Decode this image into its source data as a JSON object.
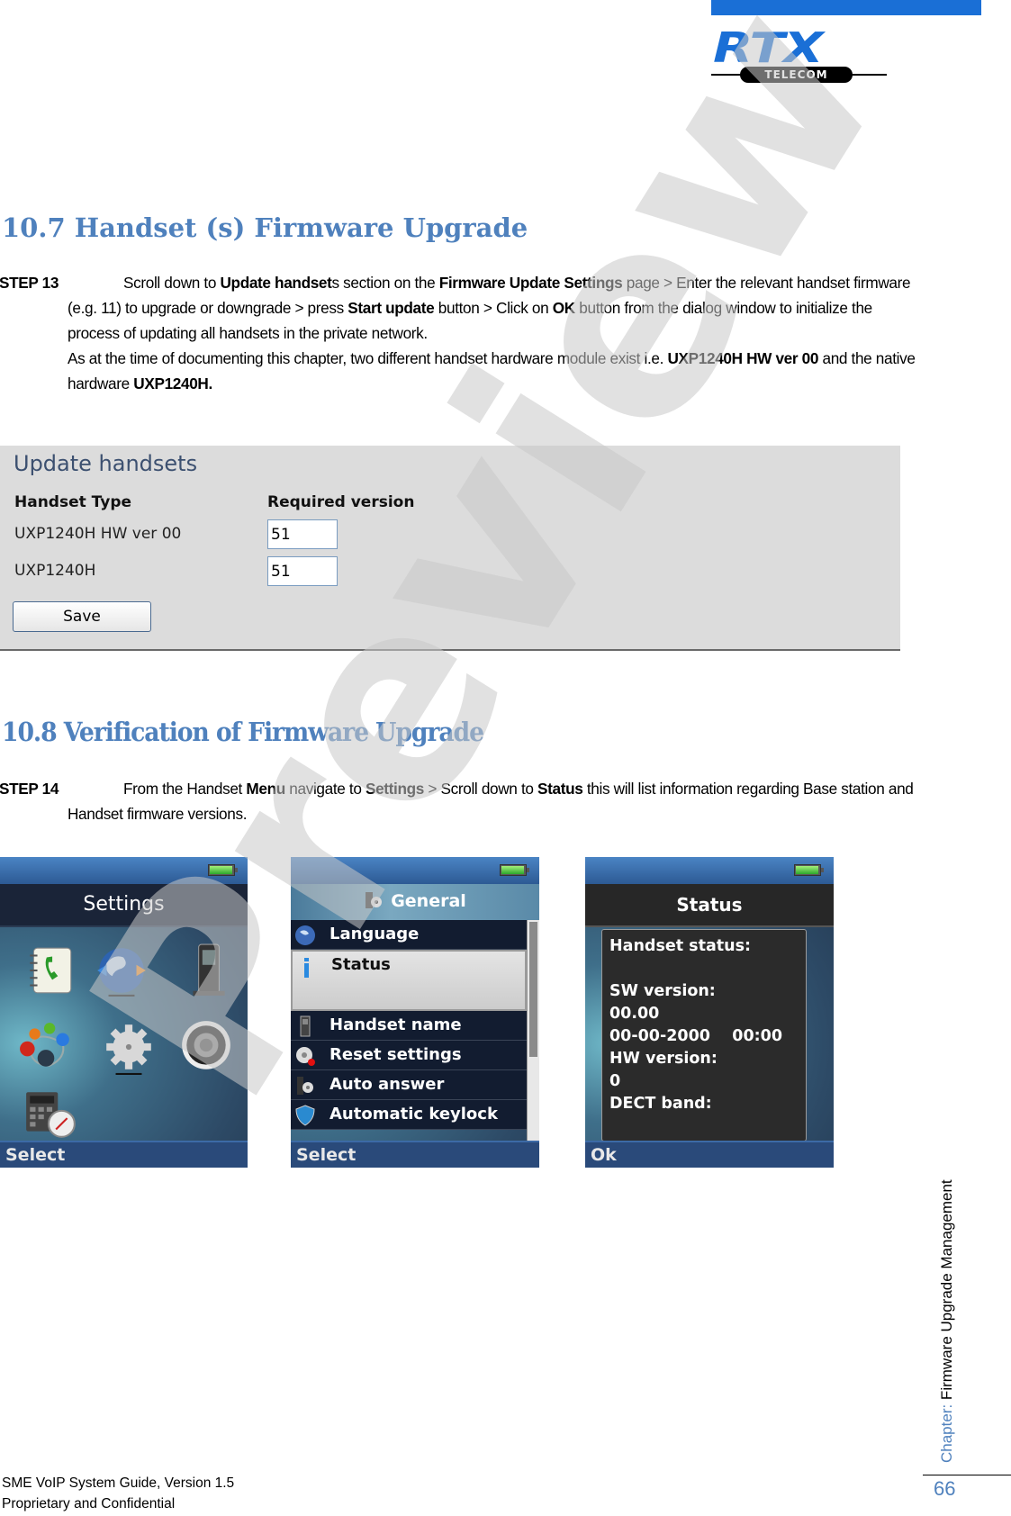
{
  "header": {
    "logo_main": "RTX",
    "logo_sub": "TELECOM"
  },
  "section1": {
    "heading": "10.7 Handset (s) Firmware Upgrade",
    "step_label": "STEP 13",
    "text": [
      {
        "t": "Scroll down to ",
        "b": false
      },
      {
        "t": "Update handset",
        "b": true
      },
      {
        "t": "s section on the ",
        "b": false
      },
      {
        "t": "Firmware Update Settings",
        "b": true
      },
      {
        "t": " page > Enter the relevant handset firmware (e.g. 11) to upgrade or downgrade > press ",
        "b": false
      },
      {
        "t": "Start update",
        "b": true
      },
      {
        "t": " button > Click on ",
        "b": false
      },
      {
        "t": "OK",
        "b": true
      },
      {
        "t": " button from the dialog window to initialize the process of updating all handsets in the private network.",
        "b": false
      }
    ],
    "note": [
      {
        "t": "As at the time of documenting this chapter, two different handset hardware module exist i.e. ",
        "b": false
      },
      {
        "t": "UXP1240H HW ver 00",
        "b": true
      },
      {
        "t": " and the native hardware ",
        "b": false
      },
      {
        "t": "UXP1240H.",
        "b": true
      }
    ]
  },
  "update_panel": {
    "title": "Update handsets",
    "col_type": "Handset Type",
    "col_version": "Required version",
    "rows": [
      {
        "type": "UXP1240H HW ver 00",
        "version": "51"
      },
      {
        "type": "UXP1240H",
        "version": "51"
      }
    ],
    "save_label": "Save"
  },
  "section2": {
    "heading": "10.8 Verification of Firmware Upgrade",
    "step_label": "STEP 14",
    "text": [
      {
        "t": "From the Handset ",
        "b": false
      },
      {
        "t": "Menu",
        "b": true
      },
      {
        "t": " navigate to ",
        "b": false
      },
      {
        "t": "Settings",
        "b": true
      },
      {
        "t": " > Scroll down to ",
        "b": false
      },
      {
        "t": "Status",
        "b": true
      },
      {
        "t": " this will list information regarding Base station and Handset firmware versions.",
        "b": false
      }
    ]
  },
  "phones": {
    "settings": {
      "title": "Settings",
      "softkey": "Select",
      "icons": [
        "phonebook-icon",
        "globe-icon",
        "handset-icon",
        "network-icon",
        "gear-icon",
        "speaker-icon",
        "calculator-timer-icon"
      ]
    },
    "general": {
      "title": "General",
      "softkey": "Select",
      "items": [
        {
          "label": "Language",
          "icon": "globe-icon",
          "selected": false
        },
        {
          "label": "Status",
          "icon": "info-icon",
          "selected": true
        },
        {
          "label": "Handset name",
          "icon": "handset-icon",
          "selected": false
        },
        {
          "label": "Reset settings",
          "icon": "reset-gear-icon",
          "selected": false
        },
        {
          "label": "Auto answer",
          "icon": "auto-answer-icon",
          "selected": false
        },
        {
          "label": "Automatic keylock",
          "icon": "shield-icon",
          "selected": false
        }
      ]
    },
    "status": {
      "title": "Status",
      "softkey": "Ok",
      "lines": [
        "Handset status:",
        "",
        "SW version:",
        "00.00",
        "00-00-2000    00:00",
        "HW version:",
        "0",
        "DECT band:"
      ]
    },
    "battery_level": 1.0
  },
  "footer": {
    "line1": "SME VoIP System Guide, Version 1.5",
    "line2": "Proprietary and Confidential"
  },
  "sidebar": {
    "chapter_key": "Chapter: ",
    "chapter_title": "Firmware Upgrade Management",
    "page_number": "66"
  },
  "watermark": "Preview"
}
